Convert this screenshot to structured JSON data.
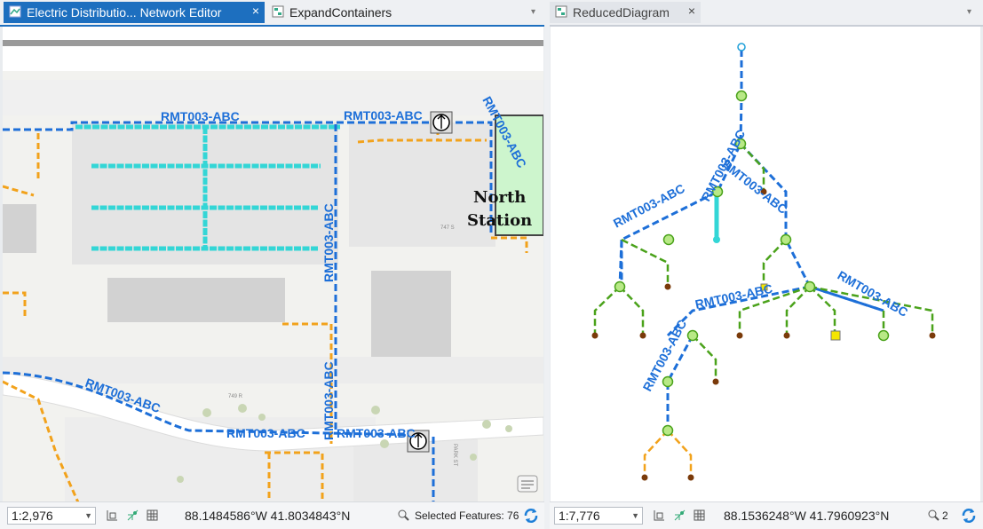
{
  "left": {
    "tabs": [
      {
        "label": "Electric Distributio... Network Editor",
        "close": "×"
      },
      {
        "label": "ExpandContainers"
      }
    ],
    "tab_menu": "▾",
    "map_labels": {
      "rmt": "RMT003-ABC",
      "station_line1": "North",
      "station_line2": "Station",
      "street1": "747 S",
      "street2": "749 R",
      "street3": "PARK ST"
    },
    "status": {
      "scale": "1:2,976",
      "coordinates": "88.1484586°W 41.8034843°N",
      "selected": "Selected Features: 76"
    }
  },
  "right": {
    "tabs": [
      {
        "label": "ReducedDiagram",
        "close": "×"
      }
    ],
    "tab_menu": "▾",
    "diagram_labels": {
      "rmt": "RMT003-ABC"
    },
    "status": {
      "scale": "1:7,776",
      "coordinates": "88.1536248°W 41.7960923°N",
      "selected_count": "2"
    }
  },
  "colors": {
    "accent": "#1d6fbf",
    "primary_line": "#1d6fd8",
    "secondary_line": "#f2a21b",
    "highlight": "#33d6d6",
    "diagram_green": "#4aa21a",
    "station_fill": "#cdf5cd"
  }
}
